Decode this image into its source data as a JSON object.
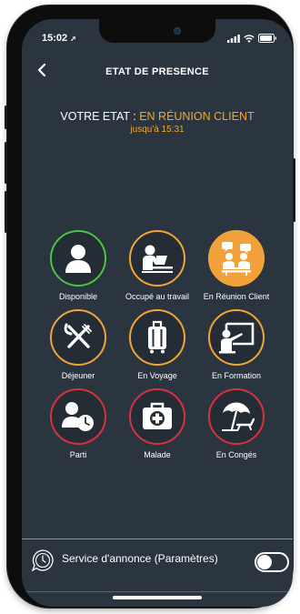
{
  "status_bar": {
    "time": "15:02"
  },
  "header": {
    "back_label": "<",
    "title": "ETAT DE PRESENCE"
  },
  "state": {
    "prefix": "VOTRE ETAT : ",
    "value": "EN RÉUNION CLIENT",
    "until": "jusqu'à 15:31"
  },
  "statuses": [
    {
      "label": "Disponible",
      "icon": "person-icon",
      "ring": "green",
      "selected": false
    },
    {
      "label": "Occupé au travail",
      "icon": "person-at-laptop-icon",
      "ring": "orange",
      "selected": false
    },
    {
      "label": "En Réunion Client",
      "icon": "meeting-icon",
      "ring": "orange",
      "selected": true
    },
    {
      "label": "Déjeuner",
      "icon": "fork-knife-icon",
      "ring": "orange",
      "selected": false
    },
    {
      "label": "En Voyage",
      "icon": "suitcase-icon",
      "ring": "orange",
      "selected": false
    },
    {
      "label": "En Formation",
      "icon": "presentation-board-icon",
      "ring": "orange",
      "selected": false
    },
    {
      "label": "Parti",
      "icon": "person-clock-icon",
      "ring": "red",
      "selected": false
    },
    {
      "label": "Malade",
      "icon": "medical-kit-icon",
      "ring": "red",
      "selected": false
    },
    {
      "label": "En Congés",
      "icon": "beach-umbrella-icon",
      "ring": "red",
      "selected": false
    }
  ],
  "colors": {
    "green": "#4cc247",
    "orange": "#f0a636",
    "red": "#d8323f",
    "background": "#2b3540"
  },
  "service": {
    "label": "Service d'annonce (Paramètres)",
    "icon": "clock-speech-icon",
    "toggle_on": false
  }
}
